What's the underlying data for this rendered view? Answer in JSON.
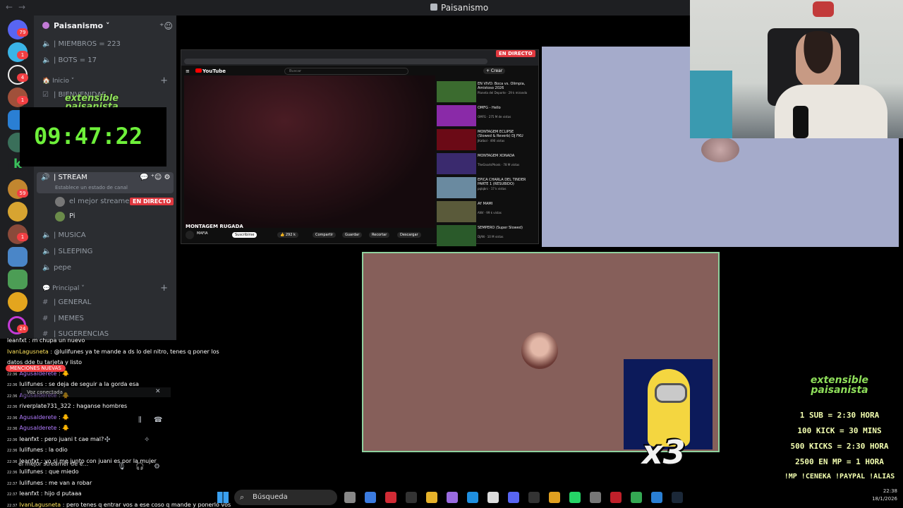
{
  "window": {
    "title": "Paisanismo",
    "back_icon": "←",
    "forward_icon": "→"
  },
  "rail": {
    "badges": [
      "79",
      "1",
      "4",
      "1",
      "59",
      "1",
      "24"
    ]
  },
  "sidebar": {
    "server_name": "Paisanismo",
    "members": "| MIEMBROS = 223",
    "bots": "| BOTS = 17",
    "cat_inicio": "Inicio",
    "bienvenidas": "| BIENVENIDAS",
    "stream_channel": "| STREAM",
    "stream_status": "Establece un estado de canal",
    "streamer_name": "el mejor streamer...",
    "live_label": "EN DIRECTO",
    "user_pi": "Pi",
    "musica": "| MUSICA",
    "sleeping": "| SLEEPING",
    "pepe": "pepe",
    "cat_principal": "Principal",
    "general": "| GENERAL",
    "memes": "| MEMES",
    "sugerencias": "| SUGERENCIAS",
    "menciones": "MENCIONES NUEVAS",
    "voice_bar": "Voz conectada",
    "user_bottom": "el mejor streamer de e..."
  },
  "overlay_logo": "extensible paisanista",
  "timer": "09:47:22",
  "youtube": {
    "live_badge": "EN DIRECTO",
    "logo": "YouTube",
    "search_placeholder": "Buscar",
    "video_title": "MONTAGEM RUGADA",
    "channel": "MAFIA",
    "subscribe": "Suscribirse",
    "likes": "292 k",
    "share": "Compartir",
    "save": "Guardar",
    "clip": "Recortar",
    "download": "Descargar",
    "create": "+ Crear",
    "recs": [
      {
        "title": "EN VIVO: Boca vs. Olimpia, Amistoso 2026",
        "meta": "Planeta del Deporte · 29 k mirando",
        "color": "#3b6b2f"
      },
      {
        "title": "OMFG - Hello",
        "meta": "OMFG · 275 M de vistas",
        "color": "#8a2aa8"
      },
      {
        "title": "MONTAGEM ECLIPSE (Slowed & Reverb) DJ FKU",
        "meta": "JKatbol · 490 vistas",
        "color": "#6b0a16"
      },
      {
        "title": "MONTAGEM XONADA",
        "meta": "TheGnarlsPhonk · 78 M vistas",
        "color": "#3a2a6e"
      },
      {
        "title": "EPICA CHARLA DEL TINDER PARTE 1 (RESUBIDO)",
        "meta": "pqlqbrc · 17 k vistas",
        "color": "#6a8aa0"
      },
      {
        "title": "AY MAMI",
        "meta": "ANV · 99 k vistas",
        "color": "#5a5a3a"
      },
      {
        "title": "SEMPERO (Super Slowed)",
        "meta": "DJAN · 10 M vistas",
        "color": "#2a5a2a"
      }
    ]
  },
  "chat": [
    {
      "time": "",
      "user": "leanfxt",
      "text": ": m chupa un nuevo",
      "color": "white"
    },
    {
      "time": "",
      "user": "IvanLagusneta",
      "text": ": @lulifunes ya te mande a ds lo del nitro, tenes q poner los",
      "color": "yellow"
    },
    {
      "time": "",
      "user": "",
      "text": "datos dde tu tarjeta y listo",
      "color": "white"
    },
    {
      "time": "22:36",
      "user": "Agusalderete",
      "text": ": 🐥",
      "color": "purple"
    },
    {
      "time": "22:36",
      "user": "lulifunes",
      "text": ": se deja de seguir a la gorda esa",
      "color": "white"
    },
    {
      "time": "22:36",
      "user": "Agusalderete",
      "text": ": 🐥",
      "color": "purple"
    },
    {
      "time": "22:36",
      "user": "riverplate731_322",
      "text": ": haganse hombres",
      "color": "white"
    },
    {
      "time": "22:36",
      "user": "Agusalderete",
      "text": ": 🐥",
      "color": "purple"
    },
    {
      "time": "22:36",
      "user": "Agusalderete",
      "text": ": 🐥",
      "color": "purple"
    },
    {
      "time": "22:36",
      "user": "leanfxt",
      "text": ": pero juani t cae mal?",
      "color": "white"
    },
    {
      "time": "22:36",
      "user": "lulifunes",
      "text": ": la odio",
      "color": "white"
    },
    {
      "time": "22:36",
      "user": "leanfxt",
      "text": ": yo si me junto con juani es por la mujer",
      "color": "white"
    },
    {
      "time": "22:36",
      "user": "lulifunes",
      "text": ": que miedo",
      "color": "white"
    },
    {
      "time": "22:37",
      "user": "lulifunes",
      "text": ": me van a robar",
      "color": "white"
    },
    {
      "time": "22:37",
      "user": "leanfxt",
      "text": ": hijo d putaaa",
      "color": "white"
    },
    {
      "time": "22:37",
      "user": "IvanLagusneta",
      "text": ": pero tenes q entrar vos a ese coso q mande y ponerlo vos",
      "color": "yellow"
    }
  ],
  "goals": {
    "logo": "extensible paisanista",
    "lines": [
      "1 SUB = 2:30 HORA",
      "100 KICK = 30 MINS",
      "500 KICKS = 2:30 HORA",
      "2500 EN MP = 1 HORA",
      "!MP !CENEKA !PAYPAL !ALIAS"
    ]
  },
  "multiplier": "x3",
  "taskbar": {
    "search_placeholder": "Búsqueda",
    "time": "22:38",
    "date": "18/1/2026",
    "icons": [
      "files-icon",
      "copilot-icon",
      "opera-icon",
      "store-icon",
      "explorer-icon",
      "pen-icon",
      "edge-icon",
      "github-icon",
      "discord-icon",
      "terminal-icon",
      "chrome-icon",
      "whatsapp-icon",
      "settings-icon",
      "app-icon",
      "chrome2-icon",
      "vscode-icon",
      "steam-icon"
    ]
  }
}
